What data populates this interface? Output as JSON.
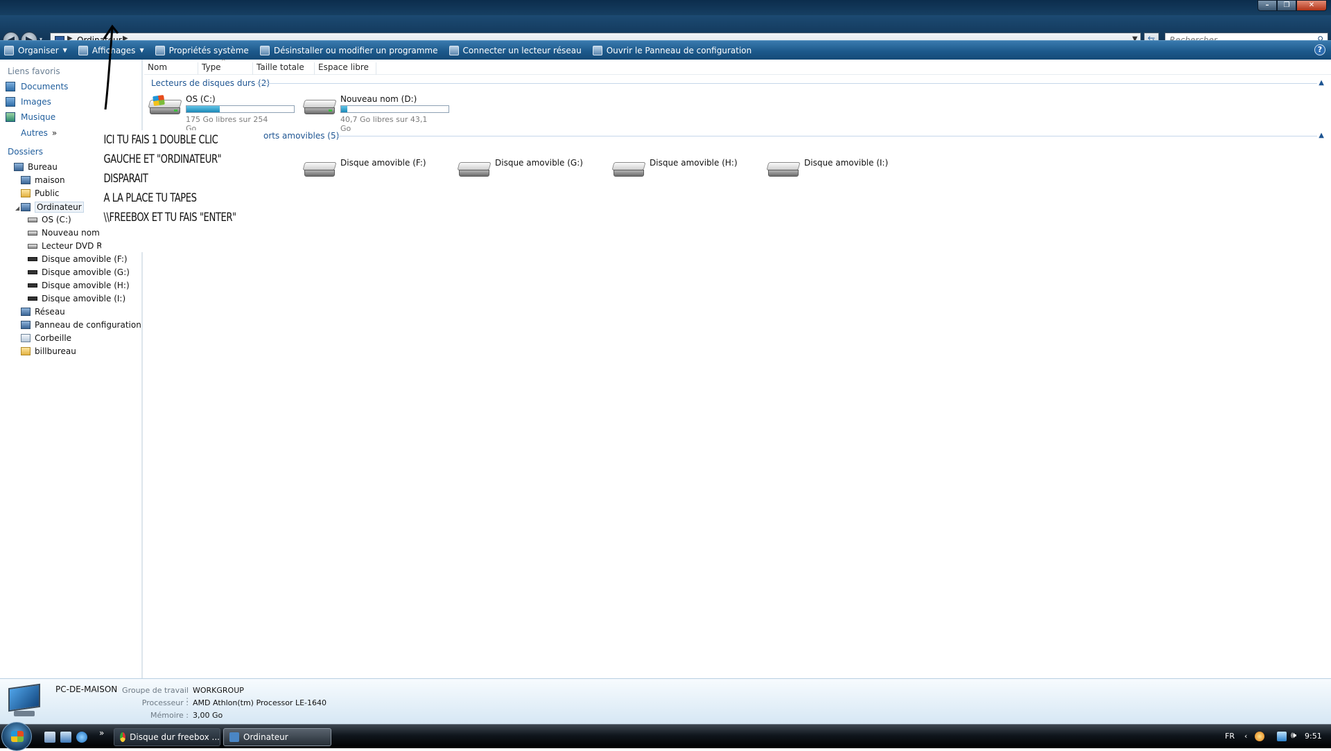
{
  "nav": {
    "breadcrumb": "Ordinateur",
    "search_placeholder": "Rechercher"
  },
  "cmdbar": {
    "items": [
      {
        "label": "Organiser",
        "icon": "organize-icon",
        "dropdown": true
      },
      {
        "label": "Affichages",
        "icon": "views-icon",
        "dropdown": true
      },
      {
        "label": "Propriétés système",
        "icon": "system-properties-icon"
      },
      {
        "label": "Désinstaller ou modifier un programme",
        "icon": "uninstall-icon"
      },
      {
        "label": "Connecter un lecteur réseau",
        "icon": "network-drive-icon"
      },
      {
        "label": "Ouvrir le Panneau de configuration",
        "icon": "control-panel-icon"
      }
    ],
    "help": "?"
  },
  "sidebar": {
    "favorites_title": "Liens favoris",
    "favorites": [
      "Documents",
      "Images",
      "Musique"
    ],
    "more": "Autres",
    "more_glyph": "»",
    "folders_title": "Dossiers",
    "tree": [
      {
        "label": "Bureau",
        "icon": "desktop-icon"
      },
      {
        "label": "maison",
        "icon": "user-folder-icon"
      },
      {
        "label": "Public",
        "icon": "folder-icon"
      },
      {
        "label": "Ordinateur",
        "icon": "computer-icon"
      },
      {
        "label": "OS (C:)",
        "icon": "os-drive-icon"
      },
      {
        "label": "Nouveau nom (D",
        "icon": "drive-icon"
      },
      {
        "label": "Lecteur DVD RW",
        "icon": "dvd-drive-icon"
      },
      {
        "label": "Disque amovible (F:)",
        "icon": "removable-drive-icon"
      },
      {
        "label": "Disque amovible (G:)",
        "icon": "removable-drive-icon"
      },
      {
        "label": "Disque amovible (H:)",
        "icon": "removable-drive-icon"
      },
      {
        "label": "Disque amovible (I:)",
        "icon": "removable-drive-icon"
      },
      {
        "label": "Réseau",
        "icon": "network-icon"
      },
      {
        "label": "Panneau de configuration",
        "icon": "control-panel-icon"
      },
      {
        "label": "Corbeille",
        "icon": "recycle-bin-icon"
      },
      {
        "label": "billbureau",
        "icon": "folder-icon"
      }
    ]
  },
  "columns": [
    "Nom",
    "Type",
    "Taille totale",
    "Espace libre"
  ],
  "groups": {
    "hard_drives": "Lecteurs de disques durs (2)",
    "removable": "orts amovibles (5)"
  },
  "hard_drives": [
    {
      "name": "OS (C:)",
      "free_text": "175 Go libres sur 254 Go",
      "used_fraction": 0.31
    },
    {
      "name": "Nouveau nom (D:)",
      "free_text": "40,7 Go libres sur 43,1 Go",
      "used_fraction": 0.06
    }
  ],
  "removable": [
    "Disque amovible (F:)",
    "Disque amovible (G:)",
    "Disque amovible (H:)",
    "Disque amovible (I:)"
  ],
  "annotation": [
    "ICI TU FAIS 1 DOUBLE CLIC",
    "GAUCHE ET \"ORDINATEUR\"",
    "DISPARAIT",
    "A LA PLACE TU TAPES",
    "\\\\FREEBOX ET TU FAIS \"ENTER\""
  ],
  "details": {
    "pc_name": "PC-DE-MAISON",
    "workgroup_label": "Groupe de travail :",
    "workgroup": "WORKGROUP",
    "processor_label": "Processeur :",
    "processor": "AMD Athlon(tm) Processor LE-1640",
    "memory_label": "Mémoire :",
    "memory": "3,00 Go"
  },
  "taskbar": {
    "more": "»",
    "buttons": [
      "Disque dur freebox ...",
      "Ordinateur"
    ],
    "lang": "FR",
    "time": "9:51"
  }
}
